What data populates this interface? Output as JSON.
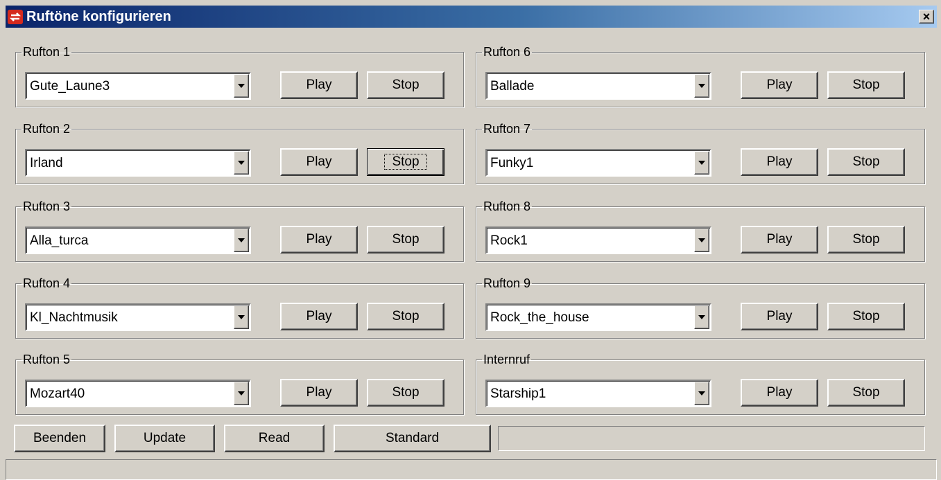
{
  "window": {
    "title": "Ruftöne konfigurieren",
    "close_label": "×"
  },
  "groups": [
    {
      "label": "Rufton 1",
      "value": "Gute_Laune3",
      "play": "Play",
      "stop": "Stop"
    },
    {
      "label": "Rufton 2",
      "value": "Irland",
      "play": "Play",
      "stop": "Stop"
    },
    {
      "label": "Rufton 3",
      "value": "Alla_turca",
      "play": "Play",
      "stop": "Stop"
    },
    {
      "label": "Rufton 4",
      "value": "Kl_Nachtmusik",
      "play": "Play",
      "stop": "Stop"
    },
    {
      "label": "Rufton 5",
      "value": "Mozart40",
      "play": "Play",
      "stop": "Stop"
    },
    {
      "label": "Rufton 6",
      "value": "Ballade",
      "play": "Play",
      "stop": "Stop"
    },
    {
      "label": "Rufton 7",
      "value": "Funky1",
      "play": "Play",
      "stop": "Stop"
    },
    {
      "label": "Rufton 8",
      "value": "Rock1",
      "play": "Play",
      "stop": "Stop"
    },
    {
      "label": "Rufton 9",
      "value": "Rock_the_house",
      "play": "Play",
      "stop": "Stop"
    },
    {
      "label": "Internruf",
      "value": "Starship1",
      "play": "Play",
      "stop": "Stop"
    }
  ],
  "footer": {
    "beenden": "Beenden",
    "update": "Update",
    "read": "Read",
    "standard": "Standard",
    "status": ""
  },
  "colors": {
    "face": "#d4d0c8",
    "title_start": "#0a246a",
    "title_end": "#a6caf0",
    "icon": "#d42a1e"
  }
}
